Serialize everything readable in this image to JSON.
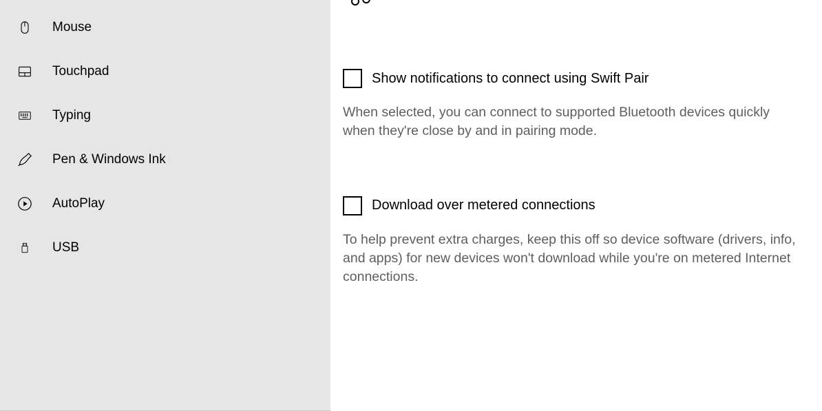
{
  "sidebar": {
    "items": [
      {
        "label": "Mouse",
        "icon": "mouse-icon"
      },
      {
        "label": "Touchpad",
        "icon": "touchpad-icon"
      },
      {
        "label": "Typing",
        "icon": "keyboard-icon"
      },
      {
        "label": "Pen & Windows Ink",
        "icon": "pen-icon"
      },
      {
        "label": "AutoPlay",
        "icon": "autoplay-icon"
      },
      {
        "label": "USB",
        "icon": "usb-icon"
      }
    ]
  },
  "content": {
    "options": [
      {
        "label": "Show notifications to connect using Swift Pair",
        "description": "When selected, you can connect to supported Bluetooth devices quickly when they're close by and in pairing mode.",
        "checked": false
      },
      {
        "label": "Download over metered connections",
        "description": "To help prevent extra charges, keep this off so device software (drivers, info, and apps) for new devices won't download while you're on metered Internet connections.",
        "checked": false
      }
    ]
  }
}
